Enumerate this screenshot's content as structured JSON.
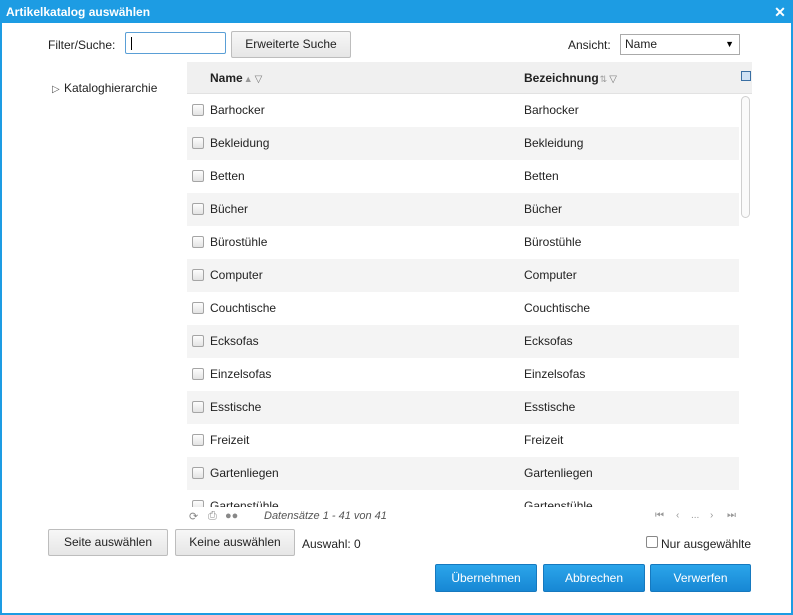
{
  "window": {
    "title": "Artikelkatalog auswählen",
    "close_icon": "close-icon"
  },
  "toolbar": {
    "filter_label": "Filter/Suche:",
    "search_value": "",
    "advanced_search_label": "Erweiterte Suche",
    "view_label": "Ansicht:",
    "view_value": "Name"
  },
  "tree": {
    "root_label": "Kataloghierarchie"
  },
  "grid": {
    "columns": [
      "Name",
      "Bezeichnung"
    ],
    "rows": [
      {
        "name": "Barhocker",
        "bezeichnung": "Barhocker"
      },
      {
        "name": "Bekleidung",
        "bezeichnung": "Bekleidung"
      },
      {
        "name": "Betten",
        "bezeichnung": "Betten"
      },
      {
        "name": "Bücher",
        "bezeichnung": "Bücher"
      },
      {
        "name": "Bürostühle",
        "bezeichnung": "Bürostühle"
      },
      {
        "name": "Computer",
        "bezeichnung": "Computer"
      },
      {
        "name": "Couchtische",
        "bezeichnung": "Couchtische"
      },
      {
        "name": "Ecksofas",
        "bezeichnung": "Ecksofas"
      },
      {
        "name": "Einzelsofas",
        "bezeichnung": "Einzelsofas"
      },
      {
        "name": "Esstische",
        "bezeichnung": "Esstische"
      },
      {
        "name": "Freizeit",
        "bezeichnung": "Freizeit"
      },
      {
        "name": "Gartenliegen",
        "bezeichnung": "Gartenliegen"
      },
      {
        "name": "Gartenstühle",
        "bezeichnung": "Gartenstühle"
      }
    ]
  },
  "pager": {
    "records_text": "Datensätze 1 - 41 von 41",
    "ellipsis": "..."
  },
  "footer": {
    "select_page_label": "Seite auswählen",
    "select_none_label": "Keine auswählen",
    "selection_text": "Auswahl: 0",
    "only_selected_label": "Nur ausgewählte",
    "accept_label": "Übernehmen",
    "cancel_label": "Abbrechen",
    "discard_label": "Verwerfen"
  },
  "colors": {
    "accent": "#1d9ce3",
    "alt_row": "#f4f4f4",
    "header_bg": "#f0f0f0"
  }
}
